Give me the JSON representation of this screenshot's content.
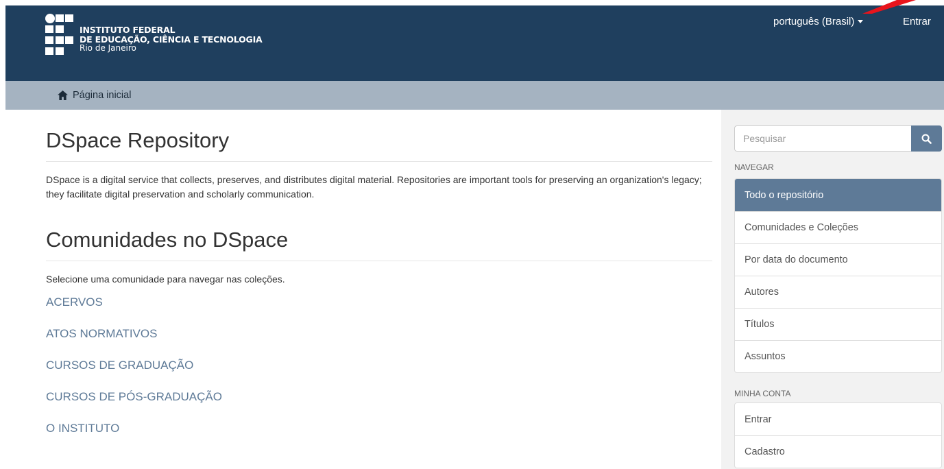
{
  "header": {
    "logo_line1": "INSTITUTO FEDERAL",
    "logo_line2": "DE EDUCAÇÃO, CIÊNCIA E TECNOLOGIA",
    "logo_line3": "Rio de Janeiro",
    "language": "português (Brasil)",
    "login": "Entrar",
    "background_color": "#1f3f5e",
    "annotation_arrow_color": "#e8141c"
  },
  "breadcrumb": {
    "home_label": "Página inicial",
    "icon": "home-icon"
  },
  "main": {
    "title": "DSpace Repository",
    "intro": "DSpace is a digital service that collects, preserves, and distributes digital material. Repositories are important tools for preserving an organization's legacy; they facilitate digital preservation and scholarly communication.",
    "communities_title": "Comunidades no DSpace",
    "communities_hint": "Selecione uma comunidade para navegar nas coleções.",
    "communities": [
      "ACERVOS",
      "ATOS NORMATIVOS",
      "CURSOS DE GRADUAÇÃO",
      "CURSOS DE PÓS-GRADUAÇÃO",
      "O INSTITUTO"
    ],
    "link_color": "#5e7a97"
  },
  "sidebar": {
    "search_placeholder": "Pesquisar",
    "search_icon": "search-icon",
    "browse_label": "NAVEGAR",
    "browse_items": [
      "Todo o repositório",
      "Comunidades e Coleções",
      "Por data do documento",
      "Autores",
      "Títulos",
      "Assuntos"
    ],
    "account_label": "MINHA CONTA",
    "account_items": [
      "Entrar",
      "Cadastro"
    ],
    "active_color": "#5e7a97"
  }
}
